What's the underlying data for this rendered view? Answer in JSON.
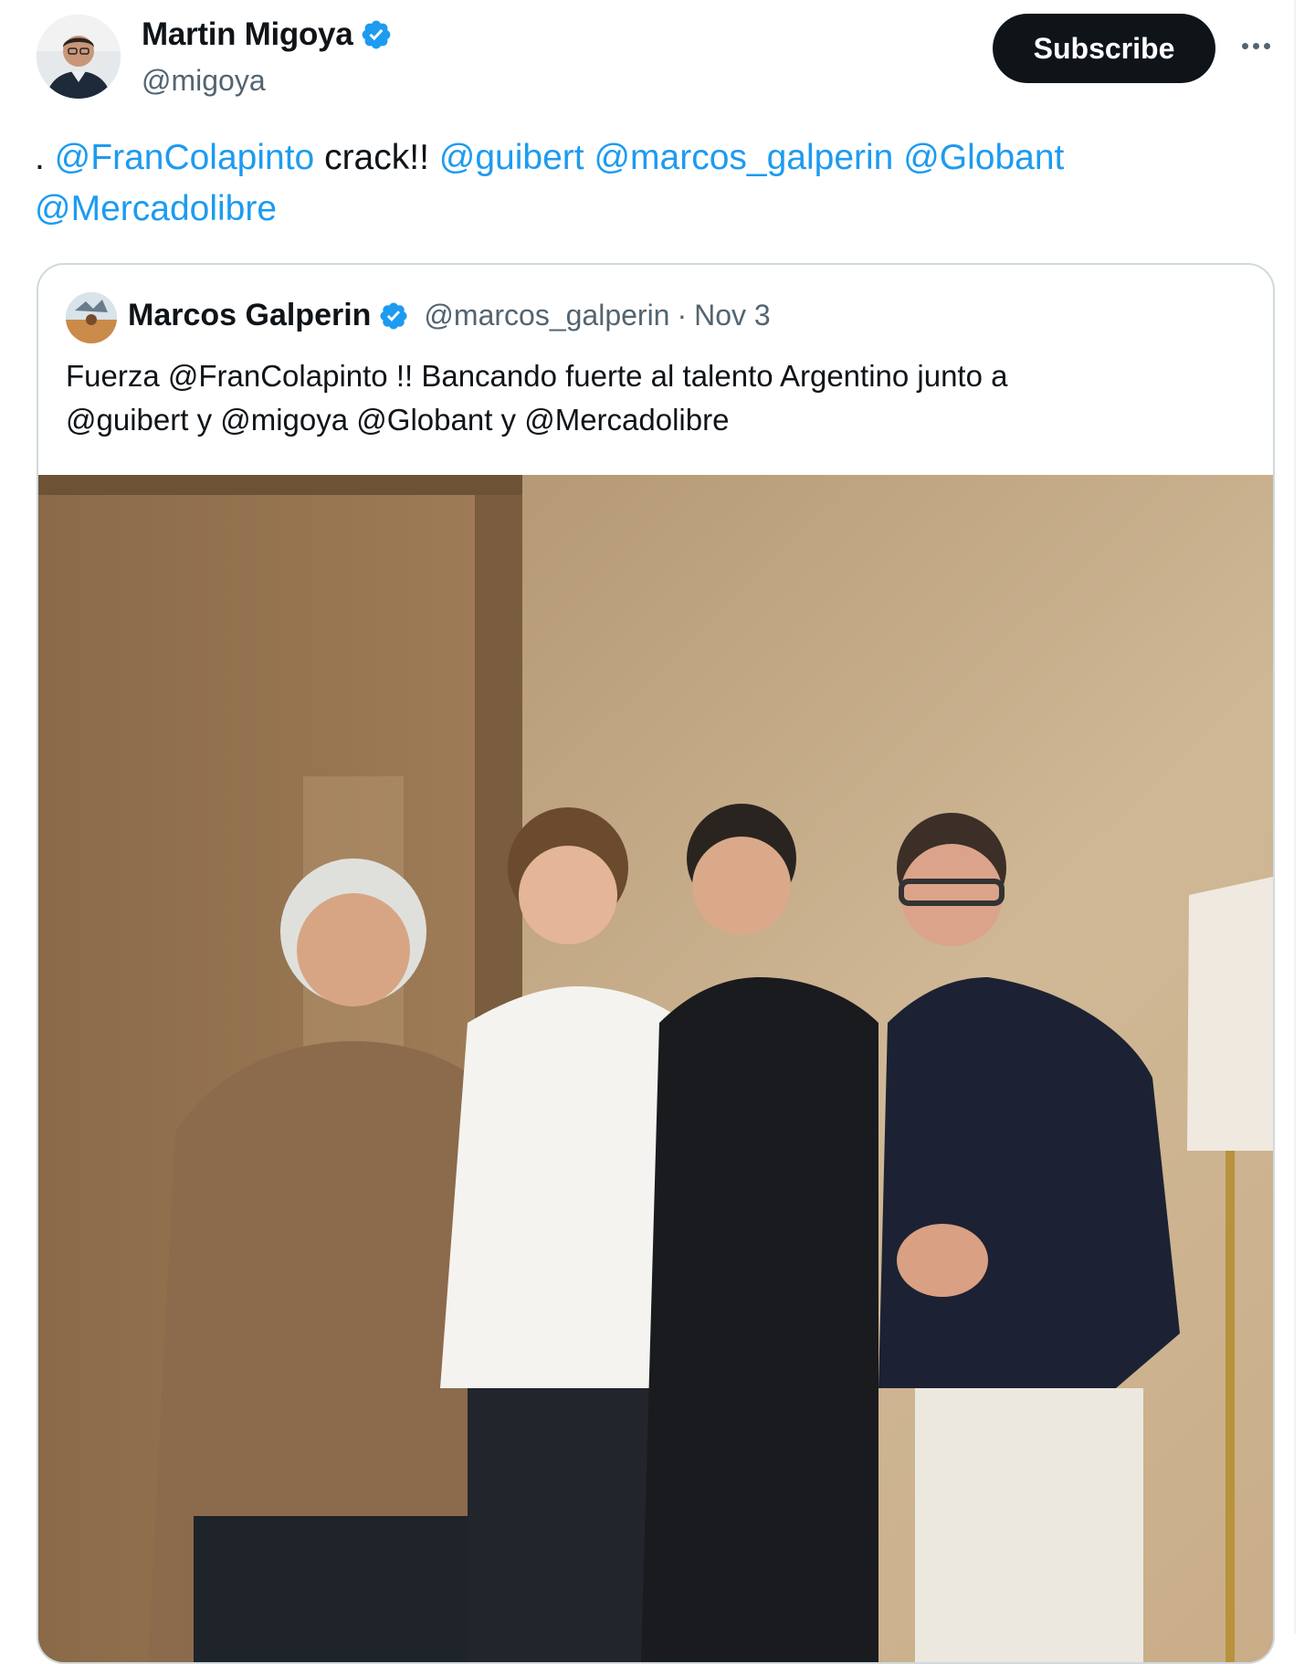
{
  "author": {
    "display_name": "Martin Migoya",
    "handle": "@migoya",
    "verified": true,
    "avatar_icon": "profile-photo"
  },
  "actions": {
    "subscribe_label": "Subscribe",
    "more_icon": "more-horizontal-icon"
  },
  "tweet": {
    "prefix": ". ",
    "mention_1": "@FranColapinto",
    "text_1": " crack!! ",
    "mention_2": "@guibert",
    "mention_3": "@marcos_galperin",
    "mention_4": "@Globant",
    "mention_5": "@Mercadolibre"
  },
  "quote": {
    "display_name": "Marcos Galperin",
    "verified": true,
    "handle": "@marcos_galperin",
    "separator": "·",
    "date": "Nov 3",
    "text_line_1": "Fuerza @FranColapinto !! Bancando fuerte al talento Argentino junto a",
    "text_line_2": "@guibert y @migoya @Globant y @Mercadolibre",
    "photo_alt": "Four men posing together in front of a wood-panelled wall"
  },
  "colors": {
    "link": "#1d9bf0",
    "text": "#0f1419",
    "secondary": "#536471",
    "button_bg": "#0f1419",
    "verified_badge": "#1d9bf0",
    "card_border": "#cfd9de"
  }
}
